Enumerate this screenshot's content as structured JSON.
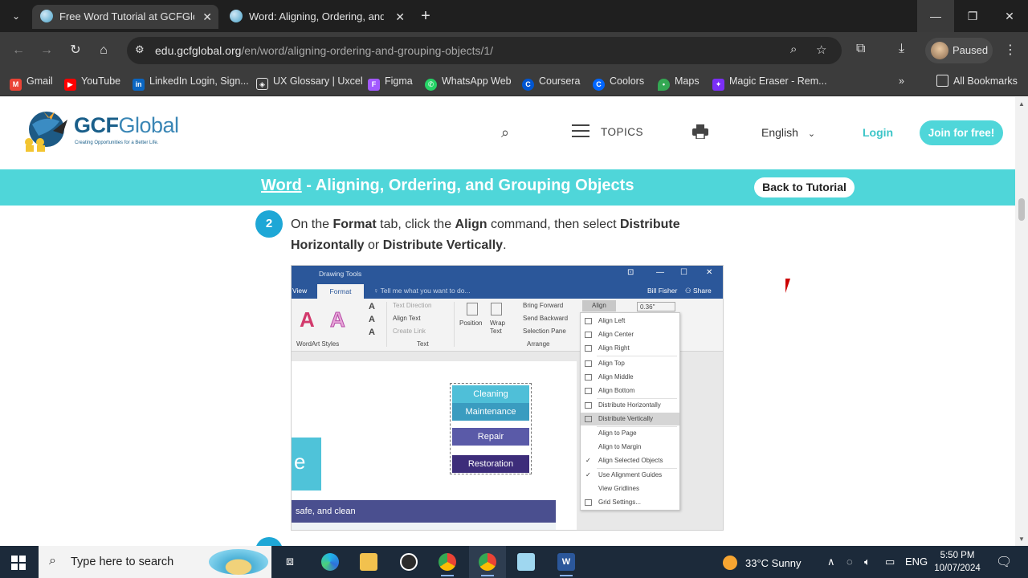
{
  "browser": {
    "tabs": [
      {
        "title": "Free Word Tutorial at GCFGlobal",
        "active": true
      },
      {
        "title": "Word: Aligning, Ordering, and Grouping",
        "active": false
      }
    ],
    "url_host": "edu.gcfglobal.org",
    "url_path": "/en/word/aligning-ordering-and-grouping-objects/1/",
    "profile_label": "Paused",
    "bookmarks": [
      {
        "label": "Gmail",
        "icon": "gmail-icon",
        "color": "#ea4335"
      },
      {
        "label": "YouTube",
        "icon": "youtube-icon",
        "color": "#ff0000"
      },
      {
        "label": "LinkedIn Login, Sign...",
        "icon": "linkedin-icon",
        "color": "#0a66c2"
      },
      {
        "label": "UX Glossary | Uxcel",
        "icon": "uxcel-icon",
        "color": "#e3e3e3"
      },
      {
        "label": "Figma",
        "icon": "figma-icon",
        "color": "#a259ff"
      },
      {
        "label": "WhatsApp Web",
        "icon": "whatsapp-icon",
        "color": "#25d366"
      },
      {
        "label": "Coursera",
        "icon": "coursera-icon",
        "color": "#0056d2"
      },
      {
        "label": "Coolors",
        "icon": "coolors-icon",
        "color": "#0066ff"
      },
      {
        "label": "Maps",
        "icon": "maps-icon",
        "color": "#34a853"
      },
      {
        "label": "Magic Eraser - Rem...",
        "icon": "magic-eraser-icon",
        "color": "#7b2ff7"
      }
    ],
    "all_bookmarks": "All Bookmarks"
  },
  "site": {
    "logo_main": "GCF",
    "logo_second": "Global",
    "logo_tagline": "Creating Opportunities for a Better Life.",
    "topics": "TOPICS",
    "language": "English",
    "login": "Login",
    "join": "Join for free!",
    "accent": "#4fd6d9"
  },
  "band": {
    "link": "Word",
    "title": " - Aligning, Ordering, and Grouping Objects",
    "back": "Back to Tutorial"
  },
  "step": {
    "number": "2",
    "t1": "On the ",
    "b1": "Format",
    "t2": " tab, click the ",
    "b2": "Align",
    "t3": " command, then select ",
    "b3": "Distribute Horizontally",
    "t4": " or ",
    "b4": "Distribute Vertically",
    "t5": "."
  },
  "word": {
    "context_title": "Drawing Tools",
    "tab_view": "View",
    "tab_format": "Format",
    "tell_me": "Tell me what you want to do...",
    "user": "Bill Fisher",
    "share": "Share",
    "ribbon": {
      "text_direction": "Text Direction",
      "align_text": "Align Text",
      "create_link": "Create Link",
      "position": "Position",
      "wrap": "Wrap",
      "text": "Text",
      "bring_forward": "Bring Forward",
      "send_backward": "Send Backward",
      "selection_pane": "Selection Pane",
      "align": "Align",
      "size": "0.36\"",
      "group_wordart": "WordArt Styles",
      "group_text": "Text",
      "group_arrange": "Arrange"
    },
    "shapes": [
      "Cleaning",
      "Maintenance",
      "Repair",
      "Restoration"
    ],
    "doc_letter": "e",
    "doc_bar": "safe, and clean",
    "menu": [
      "Align Left",
      "Align Center",
      "Align Right",
      "Align Top",
      "Align Middle",
      "Align Bottom",
      "Distribute Horizontally",
      "Distribute Vertically",
      "Align to Page",
      "Align to Margin",
      "Align Selected Objects",
      "Use Alignment Guides",
      "View Gridlines",
      "Grid Settings..."
    ]
  },
  "taskbar": {
    "search_placeholder": "Type here to search",
    "weather": "33°C  Sunny",
    "lang": "ENG",
    "time": "5:50 PM",
    "date": "10/07/2024"
  }
}
